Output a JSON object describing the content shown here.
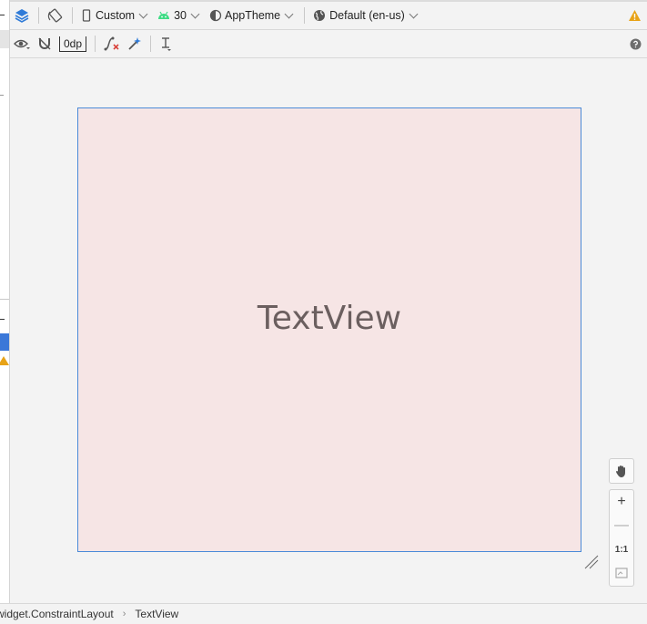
{
  "toolbar_top": {
    "device": "Custom",
    "api_level": "30",
    "theme": "AppTheme",
    "locale": "Default (en-us)"
  },
  "toolbar_second": {
    "default_margin": "0dp"
  },
  "canvas": {
    "widget_text": "TextView"
  },
  "zoom": {
    "reset_label": "1:1"
  },
  "breadcrumb": {
    "items": [
      "widget.ConstraintLayout",
      "TextView"
    ]
  },
  "colors": {
    "accent": "#3b78d8",
    "android_green": "#3ddc84",
    "warning": "#e8a317",
    "canvas_bg": "#f6e5e5"
  }
}
